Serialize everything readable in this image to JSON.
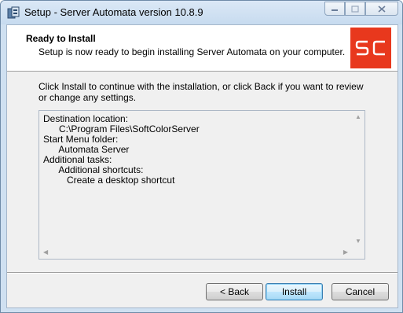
{
  "window": {
    "title": "Setup - Server Automata version 10.8.9",
    "caption_buttons": {
      "minimize": "minimize-icon",
      "maximize": "maximize-icon",
      "close": "close-icon"
    }
  },
  "header": {
    "title": "Ready to Install",
    "subtitle": "Setup is now ready to begin installing Server Automata on your computer.",
    "logo_text": "SC",
    "logo_color": "#e8381d"
  },
  "intro_text": "Click Install to continue with the installation, or click Back if you want to review or change any settings.",
  "memo": {
    "lines": [
      "Destination location:",
      "      C:\\Program Files\\SoftColorServer",
      "",
      "Start Menu folder:",
      "      Automata Server",
      "",
      "Additional tasks:",
      "      Additional shortcuts:",
      "         Create a desktop shortcut"
    ]
  },
  "buttons": {
    "back": "< Back",
    "install": "Install",
    "cancel": "Cancel"
  }
}
